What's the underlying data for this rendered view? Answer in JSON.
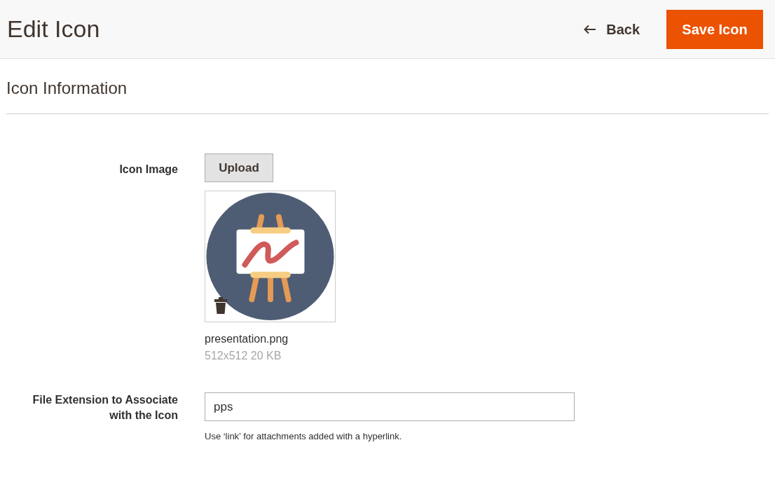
{
  "header": {
    "title": "Edit Icon",
    "back_label": "Back",
    "save_label": "Save Icon"
  },
  "section": {
    "title": "Icon Information"
  },
  "icon_image": {
    "label": "Icon Image",
    "upload_label": "Upload",
    "file_name": "presentation.png",
    "file_meta": "512x512 20 KB"
  },
  "extension": {
    "label": "File Extension to Associate with the Icon",
    "value": "pps",
    "note": "Use ‘link’ for attachments added with a hyperlink."
  }
}
